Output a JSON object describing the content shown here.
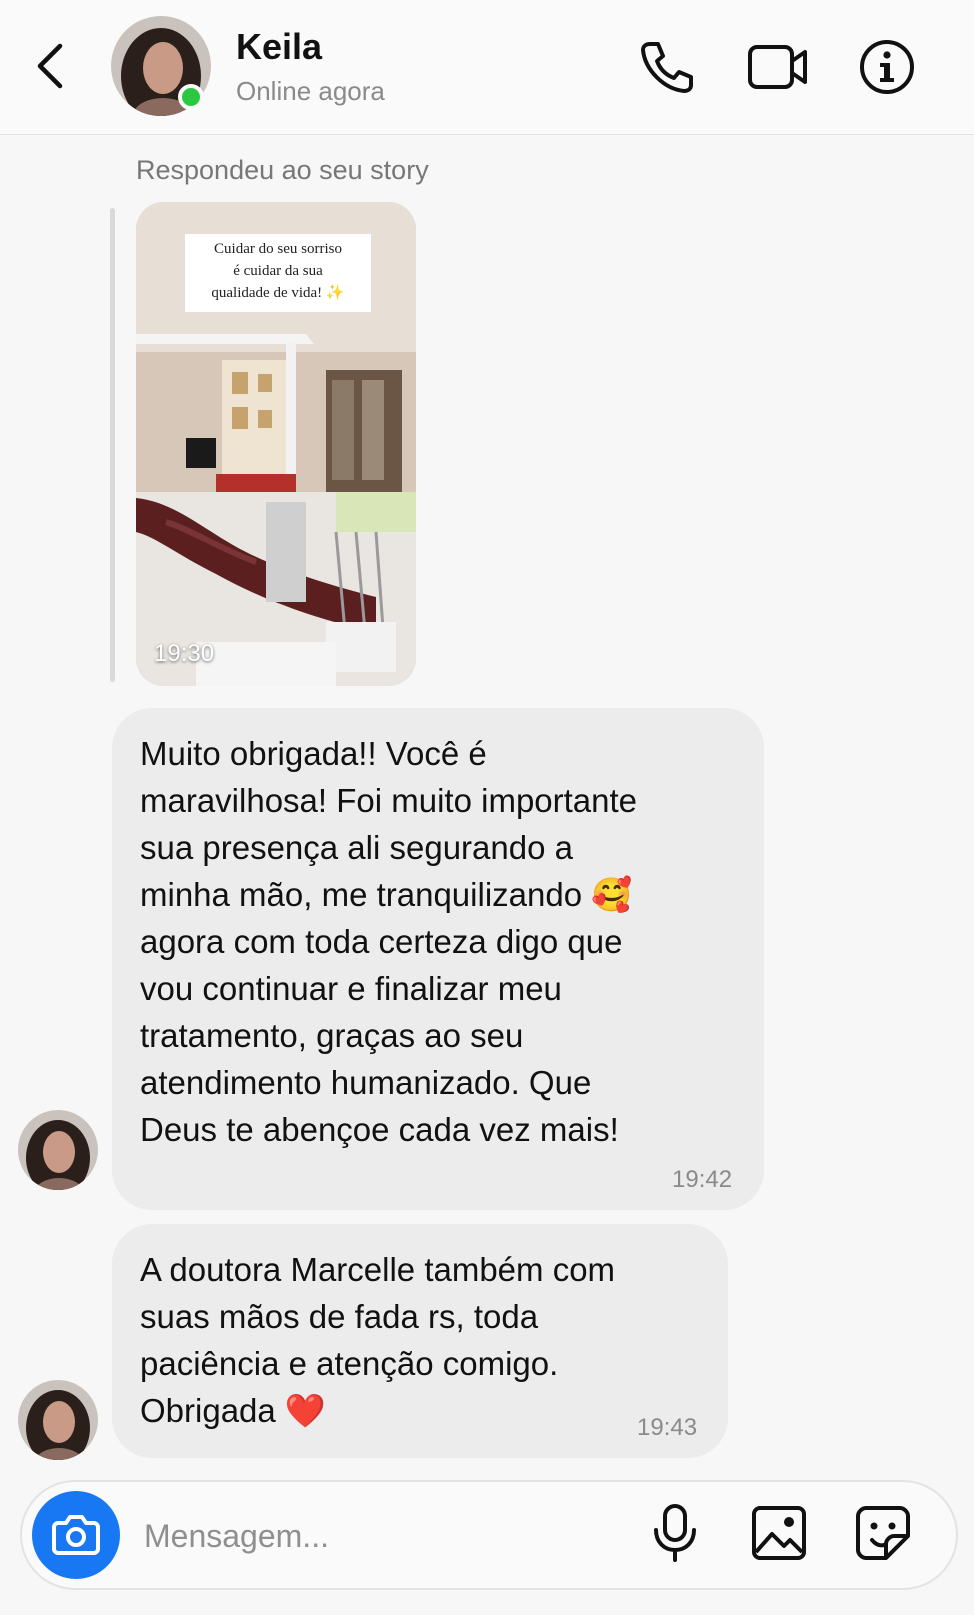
{
  "header": {
    "contact_name": "Keila",
    "status": "Online agora"
  },
  "thread": {
    "story_reply_label": "Respondeu ao seu story",
    "story": {
      "caption_lines": [
        "Cuidar do seu sorriso",
        "é cuidar da sua",
        "qualidade de vida! ✨"
      ],
      "time": "19:30"
    },
    "messages": [
      {
        "lines": [
          "Muito obrigada!! Você é",
          "maravilhosa! Foi muito importante",
          "sua presença ali segurando a",
          "minha mão, me tranquilizando 🥰",
          "agora com toda certeza digo que",
          "vou continuar e finalizar meu",
          "tratamento, graças ao seu",
          "atendimento humanizado. Que",
          "Deus te abençoe cada vez mais!"
        ],
        "time": "19:42"
      },
      {
        "lines": [
          "A doutora Marcelle também com",
          "suas mãos de fada rs, toda",
          "paciência e atenção comigo.",
          "Obrigada ❤️"
        ],
        "time": "19:43"
      }
    ]
  },
  "composer": {
    "placeholder": "Mensagem...",
    "value": ""
  },
  "icons": {
    "back": "chevron-left-icon",
    "call": "phone-icon",
    "video": "video-camera-icon",
    "info": "info-icon",
    "camera": "camera-icon",
    "mic": "microphone-icon",
    "gallery": "image-icon",
    "sticker": "sticker-icon"
  },
  "colors": {
    "online": "#29c840",
    "accent": "#1877f2",
    "bubble": "#ececec"
  }
}
